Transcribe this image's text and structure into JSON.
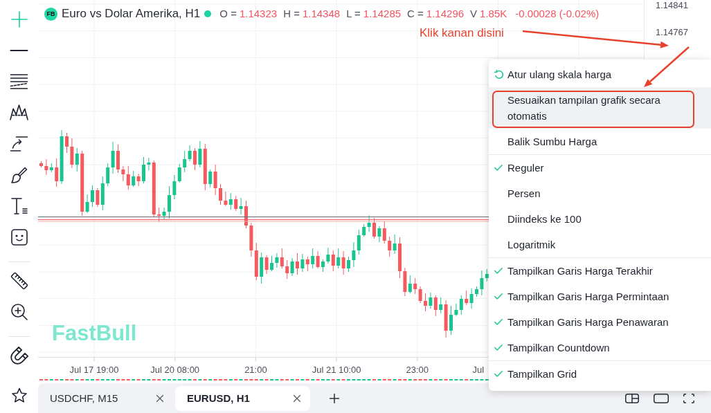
{
  "toolbar": {
    "tool_groups": [
      [
        {
          "selected": true
        },
        {
          "selected": false
        },
        {
          "selected": false
        },
        {
          "selected": false
        },
        {
          "selected": false
        },
        {
          "selected": false
        },
        {
          "selected": false
        },
        {
          "selected": false
        }
      ],
      [
        {
          "selected": false
        },
        {
          "selected": false
        }
      ],
      [
        {
          "selected": false
        }
      ]
    ]
  },
  "legend": {
    "symbol_badge": "FB",
    "title": "Euro vs Dolar Amerika, H1",
    "market_open": true,
    "falling": true,
    "fields": [
      {
        "label": "O =",
        "value": "1.14323"
      },
      {
        "label": "H =",
        "value": "1.14348"
      },
      {
        "label": "L =",
        "value": "1.14285"
      },
      {
        "label": "C =",
        "value": "1.14296"
      },
      {
        "label": "V",
        "value": "1.85K"
      }
    ],
    "change": "-0.00028 (-0.02%)"
  },
  "annotation": {
    "label": "Klik kanan disini"
  },
  "chart_logo": "FastBull",
  "price_axis": {
    "labels": [
      "1.14841",
      "1.14767"
    ]
  },
  "time_axis": {
    "labels": [
      "Jul 17 19:00",
      "Jul 20 08:00",
      "21:00",
      "Jul 21 10:00",
      "23:00",
      "Jul"
    ]
  },
  "context_menu": {
    "sections": [
      {
        "items": [
          {
            "kind": "reset",
            "label": "Atur ulang skala harga",
            "highlighted": false
          },
          {
            "kind": "action",
            "label": "Sesuaikan tampilan grafik secara otomatis",
            "highlighted": true
          },
          {
            "kind": "action",
            "label": "Balik Sumbu Harga",
            "highlighted": false
          }
        ]
      },
      {
        "items": [
          {
            "kind": "radio",
            "label": "Reguler",
            "checked": true,
            "highlighted": false
          },
          {
            "kind": "radio",
            "label": "Persen",
            "checked": false,
            "highlighted": false
          },
          {
            "kind": "radio",
            "label": "Diindeks ke 100",
            "checked": false,
            "highlighted": false
          },
          {
            "kind": "radio",
            "label": "Logaritmik",
            "checked": false,
            "highlighted": false
          }
        ]
      },
      {
        "items": [
          {
            "kind": "toggle",
            "label": "Tampilkan Garis Harga Terakhir",
            "checked": true,
            "highlighted": false
          },
          {
            "kind": "toggle",
            "label": "Tampilkan Garis Harga Permintaan",
            "checked": true,
            "highlighted": false
          },
          {
            "kind": "toggle",
            "label": "Tampilkan Garis Harga Penawaran",
            "checked": true,
            "highlighted": false
          },
          {
            "kind": "toggle",
            "label": "Tampilkan Countdown",
            "checked": true,
            "highlighted": false
          }
        ]
      },
      {
        "items": [
          {
            "kind": "toggle",
            "label": "Tampilkan Grid",
            "checked": true,
            "highlighted": false
          }
        ]
      }
    ]
  },
  "tabs": [
    {
      "label": "USDCHF, M15",
      "selected": false
    },
    {
      "label": "EURUSD, H1",
      "selected": true
    }
  ]
}
